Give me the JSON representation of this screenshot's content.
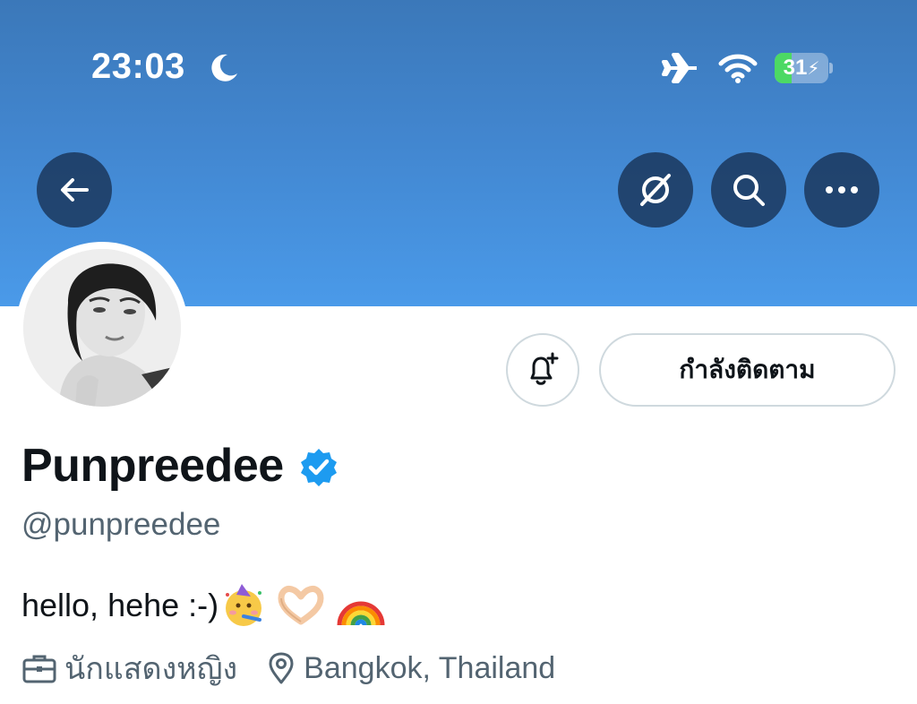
{
  "status_bar": {
    "time": "23:03",
    "battery_text": "31",
    "battery_level": 0.31,
    "icons": [
      "moon-icon",
      "airplane-icon",
      "wifi-icon",
      "battery-icon"
    ]
  },
  "header": {
    "buttons": [
      "back-arrow-icon",
      "translate-icon",
      "search-icon",
      "more-icon"
    ]
  },
  "profile": {
    "following_label": "กำลังติดตาม",
    "name": "Punpreedee",
    "handle": "@punpreedee",
    "bio": "hello, hehe :-)",
    "bio_emojis": [
      "party-face",
      "heart-hands",
      "rainbow"
    ],
    "profession": "นักแสดงหญิง",
    "location": "Bangkok, Thailand"
  },
  "colors": {
    "banner_top": "#3b78b9",
    "banner_bottom": "#4a9ae9",
    "verified": "#1d9bf0",
    "secondary_text": "#536471"
  }
}
